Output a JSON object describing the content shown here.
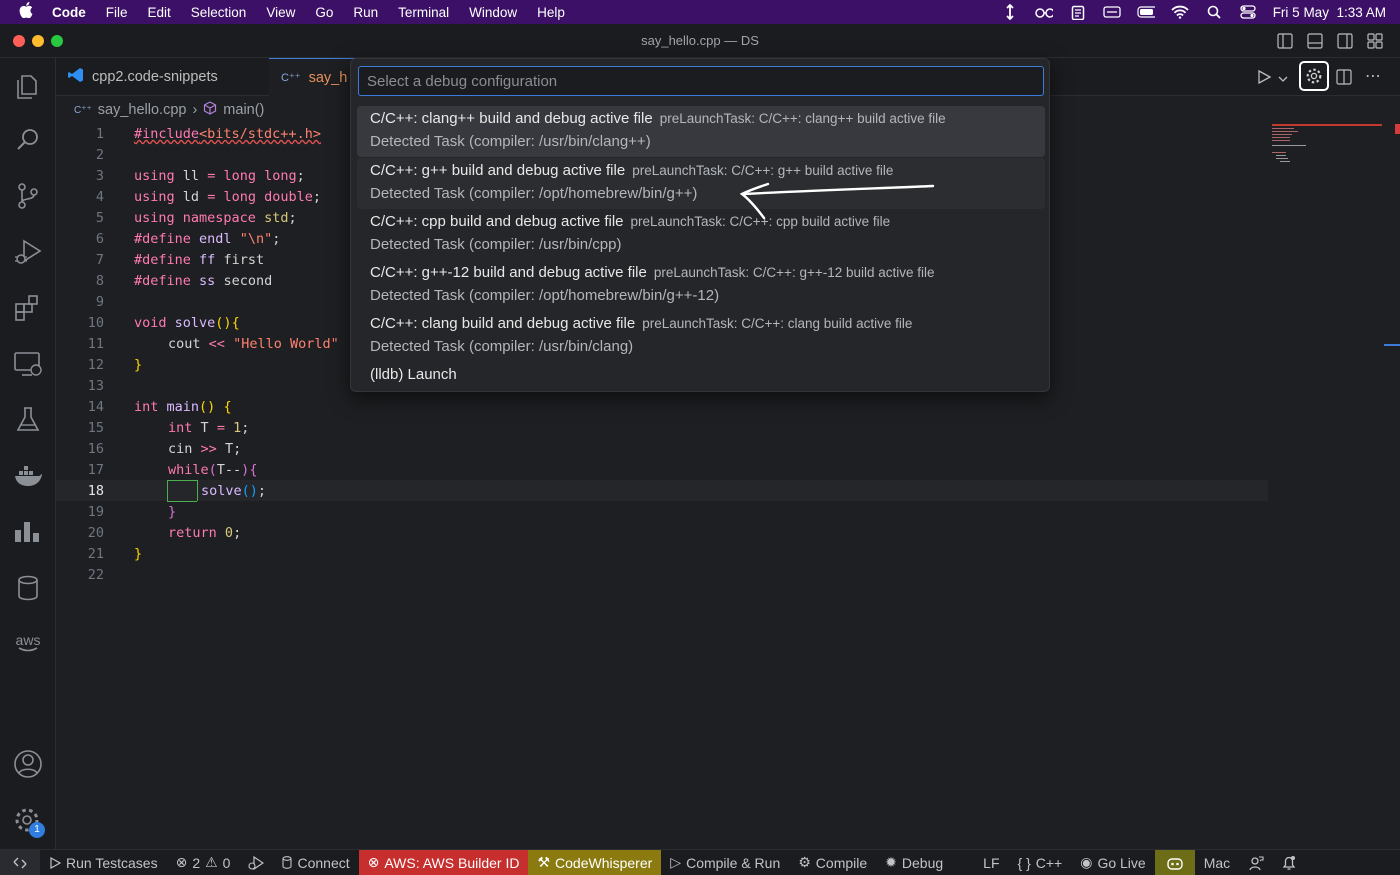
{
  "menubar": {
    "app": "Code",
    "items": [
      "File",
      "Edit",
      "Selection",
      "View",
      "Go",
      "Run",
      "Terminal",
      "Window",
      "Help"
    ],
    "datetime_day": "Fri 5 May",
    "datetime_time": "1:33 AM"
  },
  "window": {
    "title": "say_hello.cpp — DS"
  },
  "tabs": [
    {
      "label": "cpp2.code-snippets"
    },
    {
      "label": "say_hello.cpp",
      "visible_label": "say_h"
    }
  ],
  "breadcrumb": {
    "file": "say_hello.cpp",
    "symbol": "main()"
  },
  "editor": {
    "lines": [
      "1",
      "2",
      "3",
      "4",
      "5",
      "6",
      "7",
      "8",
      "9",
      "10",
      "11",
      "12",
      "13",
      "14",
      "15",
      "16",
      "17",
      "18",
      "19",
      "20",
      "21",
      "22"
    ],
    "current_line": "18",
    "code": {
      "l1a": "#include",
      "l1b": "<bits/stdc++.h>",
      "l3a": "using",
      "l3b": "ll",
      "l3c": "=",
      "l3d": "long long",
      "l4a": "using",
      "l4b": "ld",
      "l4c": "=",
      "l4d": "long double",
      "l5a": "using namespace",
      "l5b": "std",
      "l6a": "#define",
      "l6b": "endl",
      "l6c": "\"\\n\"",
      "l7a": "#define",
      "l7b": "ff",
      "l7c": "first",
      "l8a": "#define",
      "l8b": "ss",
      "l8c": "second",
      "l10a": "void",
      "l10b": "solve",
      "l11a": "cout",
      "l11b": "<<",
      "l11c": "\"Hello World\"",
      "l14a": "int",
      "l14b": "main",
      "l15a": "int",
      "l15b": "T",
      "l15c": "=",
      "l15d": "1",
      "l16a": "cin",
      "l16b": ">>",
      "l16c": "T",
      "l17a": "while",
      "l17b": "T--",
      "l18a": "solve",
      "l20a": "return",
      "l20b": "0"
    }
  },
  "quickpick": {
    "placeholder": "Select a debug configuration",
    "items": [
      {
        "label": "C/C++: clang++ build and debug active file",
        "description": "preLaunchTask: C/C++: clang++ build active file",
        "detail": "Detected Task (compiler: /usr/bin/clang++)"
      },
      {
        "label": "C/C++: g++ build and debug active file",
        "description": "preLaunchTask: C/C++: g++ build active file",
        "detail": "Detected Task (compiler: /opt/homebrew/bin/g++)"
      },
      {
        "label": "C/C++: cpp build and debug active file",
        "description": "preLaunchTask: C/C++: cpp build active file",
        "detail": "Detected Task (compiler: /usr/bin/cpp)"
      },
      {
        "label": "C/C++: g++-12 build and debug active file",
        "description": "preLaunchTask: C/C++: g++-12 build active file",
        "detail": "Detected Task (compiler: /opt/homebrew/bin/g++-12)"
      },
      {
        "label": "C/C++: clang build and debug active file",
        "description": "preLaunchTask: C/C++: clang build active file",
        "detail": "Detected Task (compiler: /usr/bin/clang)"
      },
      {
        "label": "(lldb) Launch"
      }
    ]
  },
  "statusbar": {
    "run_testcases": "Run Testcases",
    "errors": "2",
    "warnings": "0",
    "connect": "Connect",
    "aws": "AWS: AWS Builder ID",
    "codewhisperer": "CodeWhisperer",
    "compile_run": "Compile & Run",
    "compile": "Compile",
    "debug": "Debug",
    "eol": "LF",
    "lang": "C++",
    "golive": "Go Live",
    "os": "Mac"
  },
  "badges": {
    "settings": "1"
  },
  "activity_bar": {
    "aws_label": "aws"
  },
  "colors": {
    "accent": "#3d7bd9",
    "menubar": "#3b1066",
    "status_red": "#c72e2e",
    "status_olive": "#6d6d17"
  }
}
